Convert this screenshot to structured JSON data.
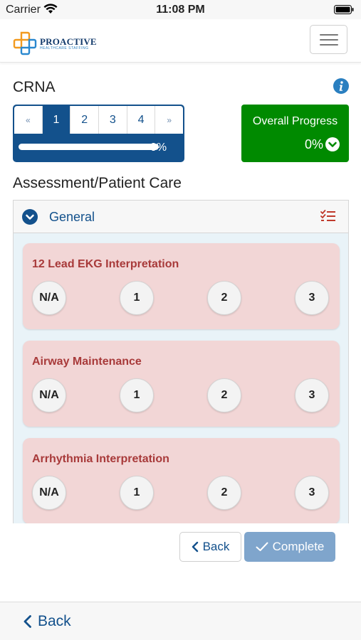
{
  "status_bar": {
    "carrier": "Carrier",
    "time": "11:08 PM"
  },
  "logo": {
    "title": "PROACTIVE",
    "subtitle": "HEALTHCARE STAFFING"
  },
  "page": {
    "title": "CRNA"
  },
  "pagination": {
    "prev": "«",
    "pages": [
      "1",
      "2",
      "3",
      "4"
    ],
    "next": "»",
    "active_page": "1"
  },
  "progress": {
    "value": 0,
    "label": "0%"
  },
  "overall_progress": {
    "label": "Overall Progress",
    "value": "0%"
  },
  "section": {
    "title": "Assessment/Patient Care"
  },
  "panel": {
    "title": "General"
  },
  "skills": [
    {
      "name": "12 Lead EKG Interpretation",
      "options": [
        "N/A",
        "1",
        "2",
        "3"
      ]
    },
    {
      "name": "Airway Maintenance",
      "options": [
        "N/A",
        "1",
        "2",
        "3"
      ]
    },
    {
      "name": "Arrhythmia Interpretation",
      "options": [
        "N/A",
        "1",
        "2",
        "3"
      ]
    }
  ],
  "actions": {
    "back": "Back",
    "complete": "Complete"
  },
  "bottom_nav": {
    "back": "Back"
  },
  "colors": {
    "primary": "#13518c",
    "success": "#008a00",
    "card_bg": "#f2d6d6",
    "card_title": "#a83a3a"
  },
  "icons": [
    "wifi-icon",
    "battery-icon",
    "hamburger-menu-icon",
    "info-icon",
    "chevron-circle-down-icon",
    "checklist-icon",
    "chevron-left-icon",
    "checkmark-icon"
  ]
}
